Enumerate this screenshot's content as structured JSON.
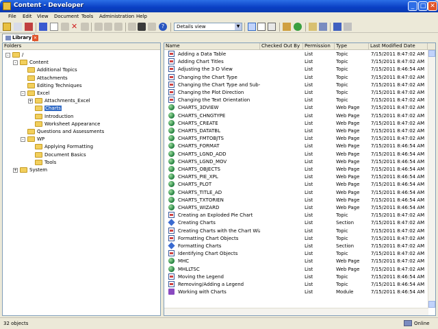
{
  "window": {
    "title": "Content - Developer"
  },
  "menu": [
    "File",
    "Edit",
    "View",
    "Document",
    "Tools",
    "Administration",
    "Help"
  ],
  "toolbar": {
    "view_select": "Details view"
  },
  "tab": {
    "label": "Library"
  },
  "folders_header": "Folders",
  "tree": [
    {
      "label": "/",
      "level": 0,
      "expander": "-"
    },
    {
      "label": "Content",
      "level": 1,
      "expander": "-"
    },
    {
      "label": "Additional Topics",
      "level": 2,
      "expander": ""
    },
    {
      "label": "Attachments",
      "level": 2,
      "expander": ""
    },
    {
      "label": "Editing Techniques",
      "level": 2,
      "expander": ""
    },
    {
      "label": "Excel",
      "level": 2,
      "expander": "-"
    },
    {
      "label": "Attachments_Excel",
      "level": 3,
      "expander": "+"
    },
    {
      "label": "Charts",
      "level": 3,
      "expander": "",
      "selected": true
    },
    {
      "label": "Introduction",
      "level": 3,
      "expander": ""
    },
    {
      "label": "Worksheet Appearance",
      "level": 3,
      "expander": ""
    },
    {
      "label": "Questions and Assessments",
      "level": 2,
      "expander": ""
    },
    {
      "label": "WP",
      "level": 2,
      "expander": "-"
    },
    {
      "label": "Applying Formatting",
      "level": 3,
      "expander": ""
    },
    {
      "label": "Document Basics",
      "level": 3,
      "expander": ""
    },
    {
      "label": "Tools",
      "level": 3,
      "expander": ""
    },
    {
      "label": "System",
      "level": 1,
      "expander": "+"
    }
  ],
  "columns": [
    "Name",
    "Checked Out By",
    "Permission",
    "Type",
    "Last Modified Date"
  ],
  "rows": [
    {
      "name": "Adding a Data Table",
      "perm": "List",
      "type": "Topic",
      "date": "7/15/2011 8:47:02 AM",
      "icon": "topic"
    },
    {
      "name": "Adding Chart Titles",
      "perm": "List",
      "type": "Topic",
      "date": "7/15/2011 8:47:02 AM",
      "icon": "topic"
    },
    {
      "name": "Adjusting the 3-D View",
      "perm": "List",
      "type": "Topic",
      "date": "7/15/2011 8:46:54 AM",
      "icon": "topic"
    },
    {
      "name": "Changing the Chart Type",
      "perm": "List",
      "type": "Topic",
      "date": "7/15/2011 8:47:02 AM",
      "icon": "topic"
    },
    {
      "name": "Changing the Chart Type and Sub-t...",
      "perm": "List",
      "type": "Topic",
      "date": "7/15/2011 8:47:02 AM",
      "icon": "topic"
    },
    {
      "name": "Changing the Plot Direction",
      "perm": "List",
      "type": "Topic",
      "date": "7/15/2011 8:47:02 AM",
      "icon": "topic"
    },
    {
      "name": "Changing the Text Orientation",
      "perm": "List",
      "type": "Topic",
      "date": "7/15/2011 8:47:02 AM",
      "icon": "topic"
    },
    {
      "name": "CHARTS_3DVIEW",
      "perm": "List",
      "type": "Web Page",
      "date": "7/15/2011 8:47:02 AM",
      "icon": "web"
    },
    {
      "name": "CHARTS_CHNGTYPE",
      "perm": "List",
      "type": "Web Page",
      "date": "7/15/2011 8:47:02 AM",
      "icon": "web"
    },
    {
      "name": "CHARTS_CREATE",
      "perm": "List",
      "type": "Web Page",
      "date": "7/15/2011 8:47:02 AM",
      "icon": "web"
    },
    {
      "name": "CHARTS_DATATBL",
      "perm": "List",
      "type": "Web Page",
      "date": "7/15/2011 8:47:02 AM",
      "icon": "web"
    },
    {
      "name": "CHARTS_FMTOBJTS",
      "perm": "List",
      "type": "Web Page",
      "date": "7/15/2011 8:47:02 AM",
      "icon": "web"
    },
    {
      "name": "CHARTS_FORMAT",
      "perm": "List",
      "type": "Web Page",
      "date": "7/15/2011 8:46:54 AM",
      "icon": "web"
    },
    {
      "name": "CHARTS_LGND_ADD",
      "perm": "List",
      "type": "Web Page",
      "date": "7/15/2011 8:46:54 AM",
      "icon": "web"
    },
    {
      "name": "CHARTS_LGND_MOV",
      "perm": "List",
      "type": "Web Page",
      "date": "7/15/2011 8:46:54 AM",
      "icon": "web"
    },
    {
      "name": "CHARTS_OBJECTS",
      "perm": "List",
      "type": "Web Page",
      "date": "7/15/2011 8:46:54 AM",
      "icon": "web"
    },
    {
      "name": "CHARTS_PIE_XPL",
      "perm": "List",
      "type": "Web Page",
      "date": "7/15/2011 8:46:54 AM",
      "icon": "web"
    },
    {
      "name": "CHARTS_PLOT",
      "perm": "List",
      "type": "Web Page",
      "date": "7/15/2011 8:46:54 AM",
      "icon": "web"
    },
    {
      "name": "CHARTS_TITLE_AD",
      "perm": "List",
      "type": "Web Page",
      "date": "7/15/2011 8:46:54 AM",
      "icon": "web"
    },
    {
      "name": "CHARTS_TXTORIEN",
      "perm": "List",
      "type": "Web Page",
      "date": "7/15/2011 8:46:54 AM",
      "icon": "web"
    },
    {
      "name": "CHARTS_WIZARD",
      "perm": "List",
      "type": "Web Page",
      "date": "7/15/2011 8:46:54 AM",
      "icon": "web"
    },
    {
      "name": "Creating an Exploded Pie Chart",
      "perm": "List",
      "type": "Topic",
      "date": "7/15/2011 8:47:02 AM",
      "icon": "topic"
    },
    {
      "name": "Creating Charts",
      "perm": "List",
      "type": "Section",
      "date": "7/15/2011 8:47:02 AM",
      "icon": "section"
    },
    {
      "name": "Creating Charts with the Chart Wizard",
      "perm": "List",
      "type": "Topic",
      "date": "7/15/2011 8:47:02 AM",
      "icon": "topic"
    },
    {
      "name": "Formatting Chart Objects",
      "perm": "List",
      "type": "Topic",
      "date": "7/15/2011 8:47:02 AM",
      "icon": "topic"
    },
    {
      "name": "Formatting Charts",
      "perm": "List",
      "type": "Section",
      "date": "7/15/2011 8:47:02 AM",
      "icon": "section"
    },
    {
      "name": "Identifying Chart Objects",
      "perm": "List",
      "type": "Topic",
      "date": "7/15/2011 8:47:02 AM",
      "icon": "topic"
    },
    {
      "name": "MHC",
      "perm": "List",
      "type": "Web Page",
      "date": "7/15/2011 8:47:02 AM",
      "icon": "web"
    },
    {
      "name": "MHLLTSC",
      "perm": "List",
      "type": "Web Page",
      "date": "7/15/2011 8:47:02 AM",
      "icon": "web"
    },
    {
      "name": "Moving the Legend",
      "perm": "List",
      "type": "Topic",
      "date": "7/15/2011 8:46:54 AM",
      "icon": "topic"
    },
    {
      "name": "Removing/Adding a Legend",
      "perm": "List",
      "type": "Topic",
      "date": "7/15/2011 8:46:54 AM",
      "icon": "topic"
    },
    {
      "name": "Working with Charts",
      "perm": "List",
      "type": "Module",
      "date": "7/15/2011 8:46:54 AM",
      "icon": "module"
    }
  ],
  "status": {
    "count": "32 objects",
    "connection": "Online"
  }
}
